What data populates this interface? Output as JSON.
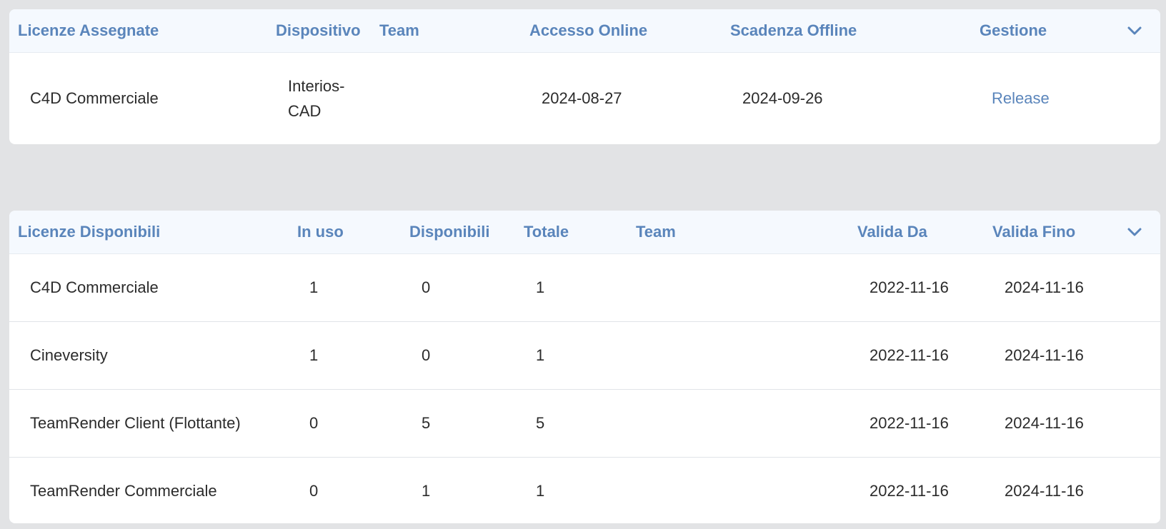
{
  "assigned": {
    "headers": {
      "license": "Licenze Assegnate",
      "device": "Dispositivo",
      "team": "Team",
      "online_access": "Accesso Online",
      "offline_expiry": "Scadenza Offline",
      "manage": "Gestione"
    },
    "rows": [
      {
        "license": "C4D Commerciale",
        "device": "Interios-CAD",
        "team": "",
        "online_access": "2024-08-27",
        "offline_expiry": "2024-09-26",
        "action": "Release"
      }
    ]
  },
  "available": {
    "headers": {
      "license": "Licenze Disponibili",
      "in_use": "In uso",
      "available": "Disponibili",
      "total": "Totale",
      "team": "Team",
      "valid_from": "Valida Da",
      "valid_until": "Valida Fino"
    },
    "rows": [
      {
        "license": "C4D Commerciale",
        "in_use": "1",
        "available": "0",
        "total": "1",
        "team": "",
        "valid_from": "2022-11-16",
        "valid_until": "2024-11-16"
      },
      {
        "license": "Cineversity",
        "in_use": "1",
        "available": "0",
        "total": "1",
        "team": "",
        "valid_from": "2022-11-16",
        "valid_until": "2024-11-16"
      },
      {
        "license": "TeamRender Client (Flottante)",
        "in_use": "0",
        "available": "5",
        "total": "5",
        "team": "",
        "valid_from": "2022-11-16",
        "valid_until": "2024-11-16"
      },
      {
        "license": "TeamRender Commerciale",
        "in_use": "0",
        "available": "1",
        "total": "1",
        "team": "",
        "valid_from": "2022-11-16",
        "valid_until": "2024-11-16"
      }
    ]
  },
  "icons": {
    "expand": "chevron-down-icon"
  },
  "colors": {
    "accent": "#5a85bb",
    "header_bg": "#f5f9fe",
    "page_bg": "#e2e3e5"
  }
}
